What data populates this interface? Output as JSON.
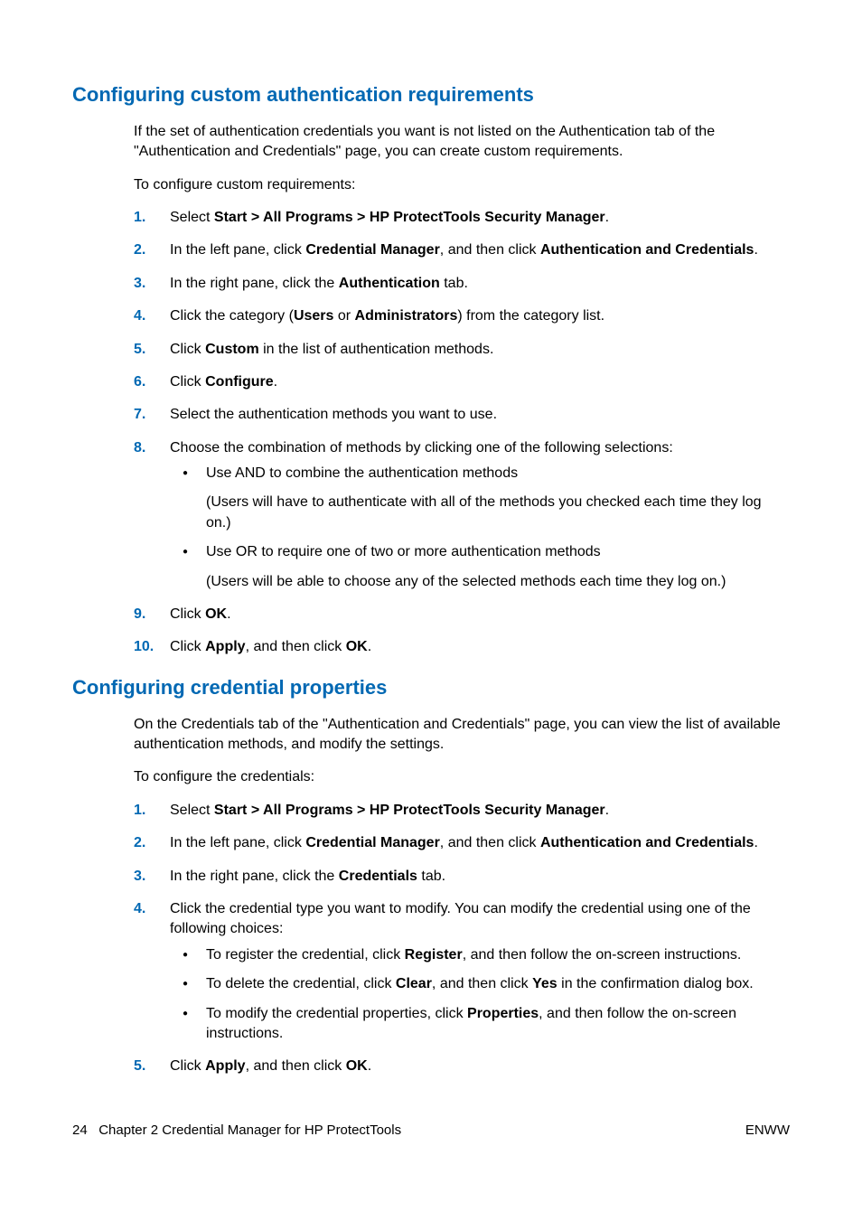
{
  "section1": {
    "heading": "Configuring custom authentication requirements",
    "intro1": "If the set of authentication credentials you want is not listed on the Authentication tab of the \"Authentication and Credentials\" page, you can create custom requirements.",
    "intro2": "To configure custom requirements:",
    "s1": {
      "n": "1.",
      "a": "Select ",
      "b": "Start > All Programs > HP ProtectTools Security Manager",
      "c": "."
    },
    "s2": {
      "n": "2.",
      "a": "In the left pane, click ",
      "b": "Credential Manager",
      "c": ", and then click ",
      "d": "Authentication and Credentials",
      "e": "."
    },
    "s3": {
      "n": "3.",
      "a": "In the right pane, click the ",
      "b": "Authentication",
      "c": " tab."
    },
    "s4": {
      "n": "4.",
      "a": "Click the category (",
      "b": "Users",
      "c": " or ",
      "d": "Administrators",
      "e": ") from the category list."
    },
    "s5": {
      "n": "5.",
      "a": "Click ",
      "b": "Custom",
      "c": " in the list of authentication methods."
    },
    "s6": {
      "n": "6.",
      "a": "Click ",
      "b": "Configure",
      "c": "."
    },
    "s7": {
      "n": "7.",
      "a": "Select the authentication methods you want to use."
    },
    "s8": {
      "n": "8.",
      "a": "Choose the combination of methods by clicking one of the following selections:"
    },
    "s8b1": {
      "a": "Use AND to combine the authentication methods",
      "b": "(Users will have to authenticate with all of the methods you checked each time they log on.)"
    },
    "s8b2": {
      "a": "Use OR to require one of two or more authentication methods",
      "b": "(Users will be able to choose any of the selected methods each time they log on.)"
    },
    "s9": {
      "n": "9.",
      "a": "Click ",
      "b": "OK",
      "c": "."
    },
    "s10": {
      "n": "10.",
      "a": "Click ",
      "b": "Apply",
      "c": ", and then click ",
      "d": "OK",
      "e": "."
    }
  },
  "section2": {
    "heading": "Configuring credential properties",
    "intro1": "On the Credentials tab of the \"Authentication and Credentials\" page, you can view the list of available authentication methods, and modify the settings.",
    "intro2": "To configure the credentials:",
    "s1": {
      "n": "1.",
      "a": "Select ",
      "b": "Start > All Programs > HP ProtectTools Security Manager",
      "c": "."
    },
    "s2": {
      "n": "2.",
      "a": "In the left pane, click ",
      "b": "Credential Manager",
      "c": ", and then click ",
      "d": "Authentication and Credentials",
      "e": "."
    },
    "s3": {
      "n": "3.",
      "a": "In the right pane, click the ",
      "b": "Credentials",
      "c": " tab."
    },
    "s4": {
      "n": "4.",
      "a": "Click the credential type you want to modify. You can modify the credential using one of the following choices:"
    },
    "s4b1": {
      "a": "To register the credential, click ",
      "b": "Register",
      "c": ", and then follow the on-screen instructions."
    },
    "s4b2": {
      "a": "To delete the credential, click ",
      "b": "Clear",
      "c": ", and then click ",
      "d": "Yes",
      "e": " in the confirmation dialog box."
    },
    "s4b3": {
      "a": "To modify the credential properties, click ",
      "b": "Properties",
      "c": ", and then follow the on-screen instructions."
    },
    "s5": {
      "n": "5.",
      "a": "Click ",
      "b": "Apply",
      "c": ", and then click ",
      "d": "OK",
      "e": "."
    }
  },
  "footer": {
    "page": "24",
    "chapter": "Chapter 2   Credential Manager for HP ProtectTools",
    "brand": "ENWW"
  }
}
